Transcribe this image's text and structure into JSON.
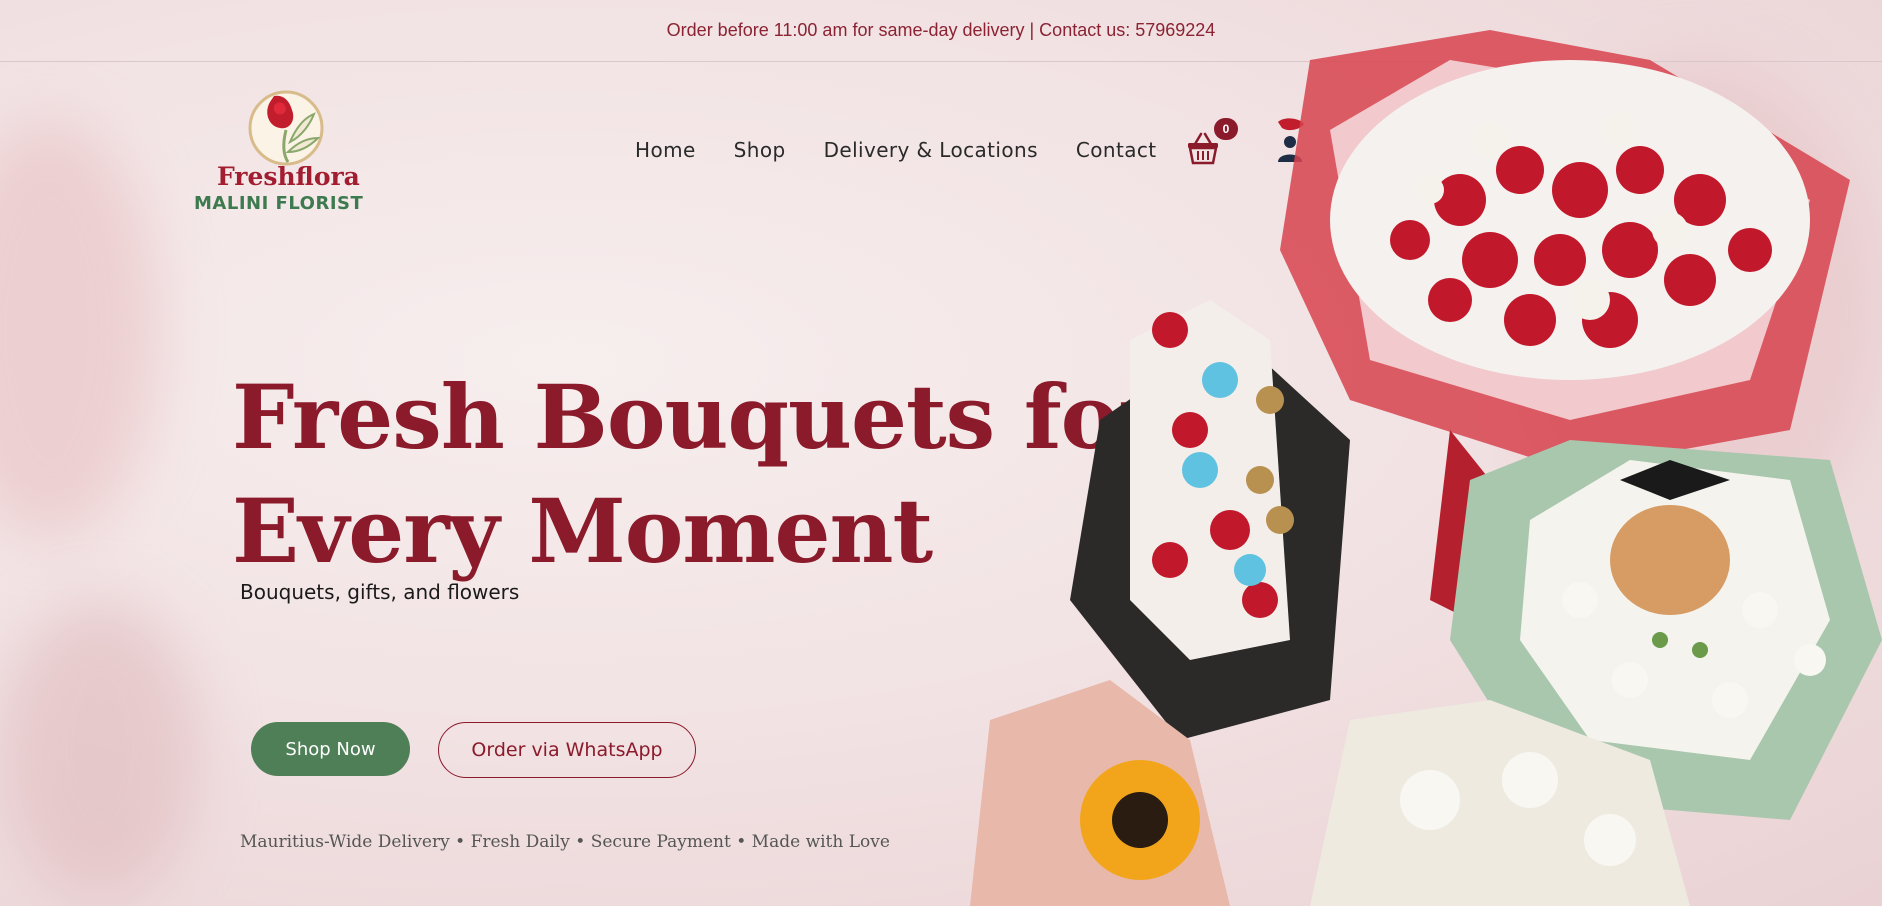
{
  "topbar": {
    "announcement": "Order before 11:00 am for same-day delivery | Contact us: 57969224"
  },
  "logo": {
    "name": "Freshflora",
    "subtitle": "MALINI FLORIST",
    "icon": "rose-logo-icon"
  },
  "nav": {
    "items": [
      "Home",
      "Shop",
      "Delivery & Locations",
      "Contact"
    ]
  },
  "cart": {
    "count": "0",
    "icon": "basket-icon"
  },
  "account": {
    "icon": "user-icon"
  },
  "hero": {
    "headline_line1": "Fresh Bouquets for",
    "headline_line2": "Every Moment",
    "subline": "Bouquets, gifts, and flowers",
    "shop_button": "Shop Now",
    "whatsapp_button": "Order via WhatsApp",
    "features": "Mauritius-Wide Delivery • Fresh Daily • Secure Payment • Made with Love"
  },
  "colors": {
    "brand_red": "#8b1a2b",
    "brand_green": "#4f7f57",
    "logo_green": "#3d7a4f"
  }
}
